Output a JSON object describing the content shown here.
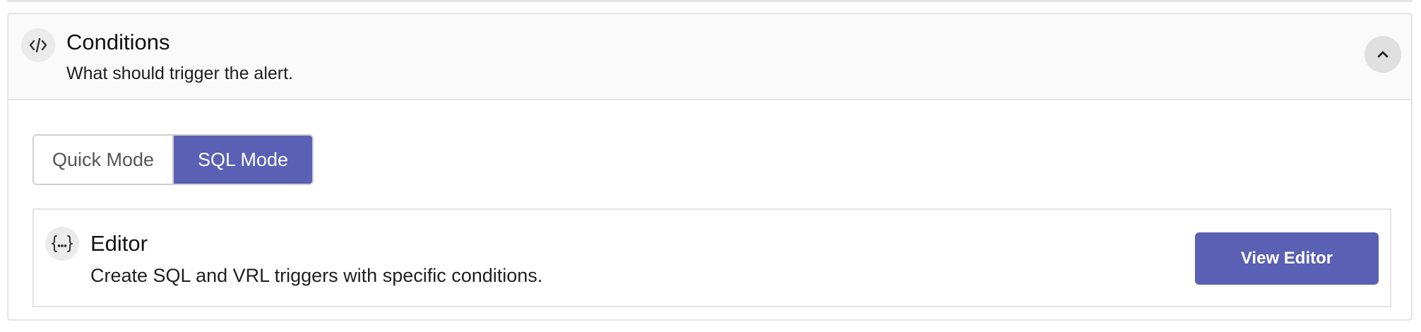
{
  "colors": {
    "accent": "#5a60b4",
    "border": "#e3e3e3",
    "header_bg": "#fafafa"
  },
  "conditions": {
    "title": "Conditions",
    "subtitle": "What should trigger the alert.",
    "icon": "code-icon",
    "collapse_icon": "chevron-up-icon"
  },
  "mode_toggle": {
    "options": [
      {
        "label": "Quick Mode",
        "selected": false
      },
      {
        "label": "SQL Mode",
        "selected": true
      }
    ]
  },
  "editor": {
    "icon": "curly-braces-icon",
    "title": "Editor",
    "description": "Create SQL and VRL triggers with specific conditions.",
    "button_label": "View Editor"
  }
}
